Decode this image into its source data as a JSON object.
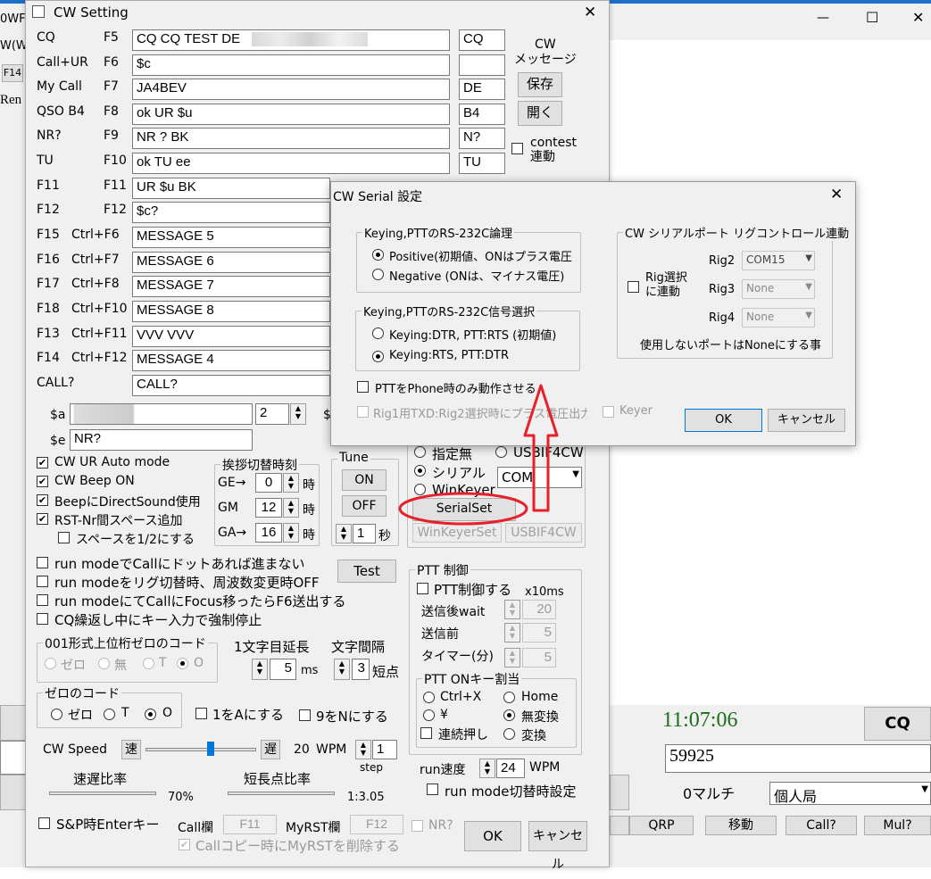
{
  "bg": {
    "title_frag": "0WF",
    "frag2": "W(W",
    "frag3": "F14",
    "frag4": "Ren",
    "win_min": "—",
    "win_max": "☐",
    "win_close": "✕",
    "time": "11:07:06",
    "cq_btn": "CQ",
    "rst": "59925",
    "zero_multi": "0マルチ",
    "station_type": "個人局",
    "btn_qrp": "QRP",
    "btn_move": "移動",
    "btn_call": "Call?",
    "btn_mul": "Mul?"
  },
  "cw": {
    "title": "CW Setting",
    "close": "✕",
    "rows": [
      {
        "label": "CQ",
        "key": "F5",
        "msg": "CQ CQ  TEST DE",
        "short": "CQ"
      },
      {
        "label": "Call+UR",
        "key": "F6",
        "msg": "$c",
        "short": ""
      },
      {
        "label": "My Call",
        "key": "F7",
        "msg": "JA4BEV",
        "short": "DE"
      },
      {
        "label": "QSO B4",
        "key": "F8",
        "msg": "ok UR $u",
        "short": "B4"
      },
      {
        "label": "NR?",
        "key": "F9",
        "msg": "NR ?  BK",
        "short": "N?"
      },
      {
        "label": "TU",
        "key": "F10",
        "msg": "ok TU ee",
        "short": "TU"
      },
      {
        "label": "F11",
        "key": "F11",
        "msg": "UR $u BK",
        "short": ""
      },
      {
        "label": "F12",
        "key": "F12",
        "msg": "$c?",
        "short": ""
      },
      {
        "label": "F15",
        "key": "Ctrl+F6",
        "msg": "MESSAGE 5",
        "short": ""
      },
      {
        "label": "F16",
        "key": "Ctrl+F7",
        "msg": "MESSAGE 6",
        "short": ""
      },
      {
        "label": "F17",
        "key": "Ctrl+F8",
        "msg": "MESSAGE 7",
        "short": ""
      },
      {
        "label": "F18",
        "key": "Ctrl+F10",
        "msg": "MESSAGE 8",
        "short": ""
      },
      {
        "label": "F13",
        "key": "Ctrl+F11",
        "msg": "VVV VVV",
        "short": ""
      },
      {
        "label": "F14",
        "key": "Ctrl+F12",
        "msg": "MESSAGE 4",
        "short": ""
      }
    ],
    "call_label": "CALL?",
    "call_value": "CALL?",
    "msg_title": "CW\nメッセージ",
    "save": "保存",
    "open": "開く",
    "contest_link": "contest\n連動",
    "a_label": "$a",
    "a_num": "2",
    "e_label": "$e",
    "e_value": "NR?",
    "s_label": "$",
    "opt_ur_auto": "CW UR Auto mode",
    "opt_beep": "CW Beep ON",
    "opt_directsound": "BeepにDirectSound使用",
    "opt_rst_space": "RST-Nr間スペース追加",
    "opt_half_space": "スペースを1/2にする",
    "greet_title": "挨拶切替時刻",
    "greet_ge": "GE→",
    "greet_ge_v": "0",
    "greet_gm": "GM",
    "greet_gm_v": "12",
    "greet_ga": "GA→",
    "greet_ga_v": "16",
    "hour": "時",
    "tune_title": "Tune",
    "tune_on": "ON",
    "tune_off": "OFF",
    "tune_sec_v": "1",
    "tune_sec": "秒",
    "port_none": "指定無",
    "port_usb": "USBIF4CW",
    "port_serial": "シリアル",
    "port_winkeyer": "WinKeyer",
    "com": "COM",
    "serialset": "SerialSet",
    "winkeyerset": "WinKeyerSet",
    "usbif4cw": "USBIF4CW",
    "run1": "run modeでCallにドットあれば進まない",
    "run2": "run modeをリグ切替時、周波数変更時OFF",
    "run3": "run modeにてCallにFocus移ったらF6送出する",
    "run4": "CQ繰返し中にキー入力で強制停止",
    "test": "Test",
    "z001_title": "001形式上位桁ゼロのコード",
    "z001_opts": [
      "ゼロ",
      "無",
      "T",
      "O"
    ],
    "first_ext": "1文字目延長",
    "first_ext_v": "5",
    "ms": "ms",
    "char_gap": "文字間隔",
    "char_gap_v": "3",
    "short_pt": "短点",
    "zero_title": "ゼロのコード",
    "zero_opts": [
      "ゼロ",
      "T",
      "O"
    ],
    "one_a": "1をAにする",
    "nine_n": "9をNにする",
    "ptt_title": "PTT 制御",
    "ptt_ctl": "PTT制御する",
    "x10ms": "x10ms",
    "ptt_after": "送信後wait",
    "ptt_after_v": "20",
    "ptt_before": "送信前",
    "ptt_before_v": "5",
    "ptt_timer": "タイマー(分)",
    "ptt_timer_v": "5",
    "pttkey_title": "PTT ONキー割当",
    "k_ctrlx": "Ctrl+X",
    "k_home": "Home",
    "k_yen": "¥",
    "k_muhen": "無変換",
    "k_renzoku": "連続押し",
    "k_henkan": "変換",
    "speed_label": "CW Speed",
    "fast": "速",
    "slow": "遅",
    "wpm_v": "20",
    "wpm": "WPM",
    "step_v": "1",
    "step": "step",
    "ratio1": "速遅比率",
    "ratio1_v": "70%",
    "ratio2": "短長点比率",
    "ratio2_v": "1:3.05",
    "run_speed": "run速度",
    "run_speed_v": "24",
    "run_wpm": "WPM",
    "run_switch": "run mode切替時設定",
    "sp_enter": "S&P時Enterキー",
    "call_field": "Call欄",
    "call_field_v": "F11",
    "myrst_field": "MyRST欄",
    "myrst_field_v": "F12",
    "nr_q": "NR?",
    "copy_del": "Callコピー時にMyRSTを削除する",
    "ok": "OK",
    "cancel": "キャンセル"
  },
  "serial": {
    "title": "CW Serial 設定",
    "close": "✕",
    "logic_title": "Keying,PTTのRS-232C論理",
    "positive": "Positive(初期値、ONはプラス電圧",
    "negative": "Negative (ONは、マイナス電圧)",
    "sig_title": "Keying,PTTのRS-232C信号選択",
    "dtr": "Keying:DTR, PTT:RTS (初期値)",
    "rts": "Keying:RTS, PTT:DTR",
    "ptt_phone": "PTTをPhone時のみ動作させる",
    "rig1": "Rig1用TXD:Rig2選択時にプラス電圧出力",
    "keyer": "Keyer",
    "rig_title": "CW シリアルポート リグコントロール連動",
    "rig_sel": "Rig選択\nに連動",
    "rig2": "Rig2",
    "rig2_v": "COM15",
    "rig3": "Rig3",
    "rig3_v": "None",
    "rig4": "Rig4",
    "rig4_v": "None",
    "note": "使用しないポートはNoneにする事",
    "ok": "OK",
    "cancel": "キャンセル"
  },
  "colors": {
    "annotation": "#e8202a",
    "time": "#1a6e1a"
  }
}
